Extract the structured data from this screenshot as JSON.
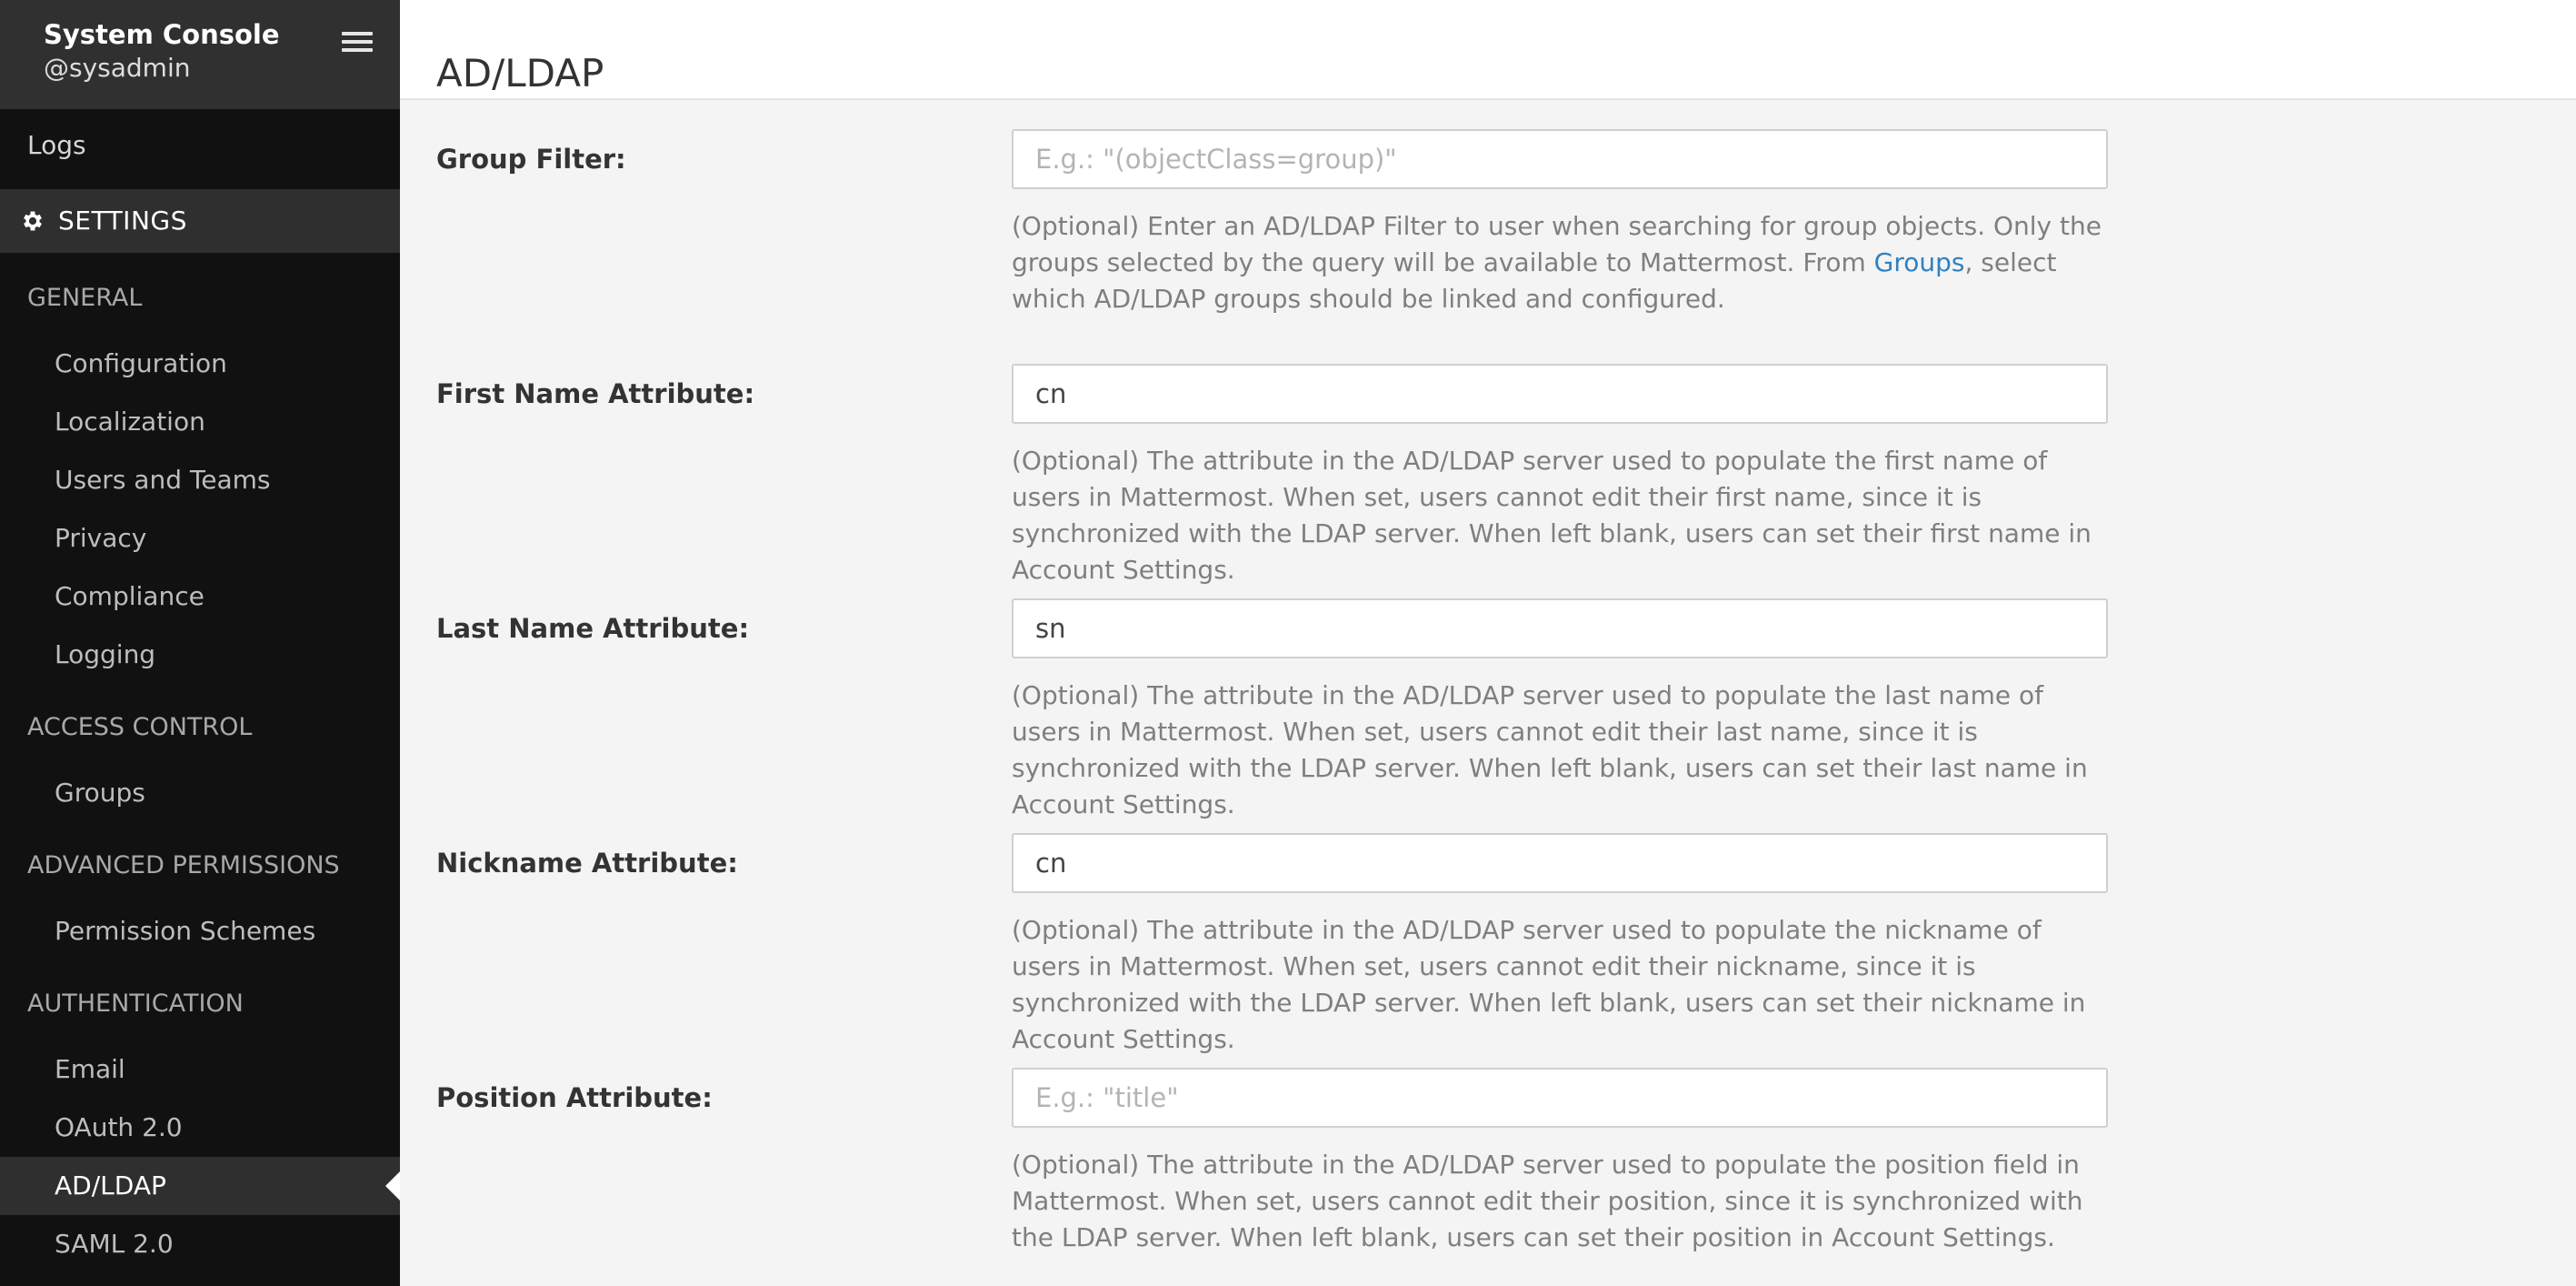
{
  "sidebar": {
    "title": "System Console",
    "user": "@sysadmin",
    "logs": "Logs",
    "settings": "SETTINGS",
    "sections": {
      "general": "GENERAL",
      "access_control": "ACCESS CONTROL",
      "advanced_permissions": "ADVANCED PERMISSIONS",
      "authentication": "AUTHENTICATION"
    },
    "general_items": [
      "Configuration",
      "Localization",
      "Users and Teams",
      "Privacy",
      "Compliance",
      "Logging"
    ],
    "access_items": [
      "Groups"
    ],
    "permission_items": [
      "Permission Schemes"
    ],
    "auth_items": [
      "Email",
      "OAuth 2.0",
      "AD/LDAP",
      "SAML 2.0"
    ],
    "active_item": "AD/LDAP"
  },
  "page": {
    "title": "AD/LDAP"
  },
  "fields": [
    {
      "label": "Group Filter:",
      "value": "",
      "placeholder": "E.g.: \"(objectClass=group)\"",
      "help_before": "(Optional) Enter an AD/LDAP Filter to user when searching for group objects. Only the groups selected by the query will be available to Mattermost. From ",
      "help_link": "Groups",
      "help_after": ", select which AD/LDAP groups should be linked and configured."
    },
    {
      "label": "First Name Attribute:",
      "value": "cn",
      "placeholder": "",
      "help": "(Optional) The attribute in the AD/LDAP server used to populate the first name of users in Mattermost. When set, users cannot edit their first name, since it is synchronized with the LDAP server. When left blank, users can set their first name in Account Settings."
    },
    {
      "label": "Last Name Attribute:",
      "value": "sn",
      "placeholder": "",
      "help": "(Optional) The attribute in the AD/LDAP server used to populate the last name of users in Mattermost. When set, users cannot edit their last name, since it is synchronized with the LDAP server. When left blank, users can set their last name in Account Settings."
    },
    {
      "label": "Nickname Attribute:",
      "value": "cn",
      "placeholder": "",
      "help": "(Optional) The attribute in the AD/LDAP server used to populate the nickname of users in Mattermost. When set, users cannot edit their nickname, since it is synchronized with the LDAP server. When left blank, users can set their nickname in Account Settings."
    },
    {
      "label": "Position Attribute:",
      "value": "",
      "placeholder": "E.g.: \"title\"",
      "help": "(Optional) The attribute in the AD/LDAP server used to populate the position field in Mattermost. When set, users cannot edit their position, since it is synchronized with the LDAP server. When left blank, users can set their position in Account Settings."
    }
  ],
  "colors": {
    "sidebar_bg": "#111111",
    "sidebar_header_bg": "#303030",
    "link": "#2f81c1",
    "page_bg": "#f4f4f4"
  }
}
